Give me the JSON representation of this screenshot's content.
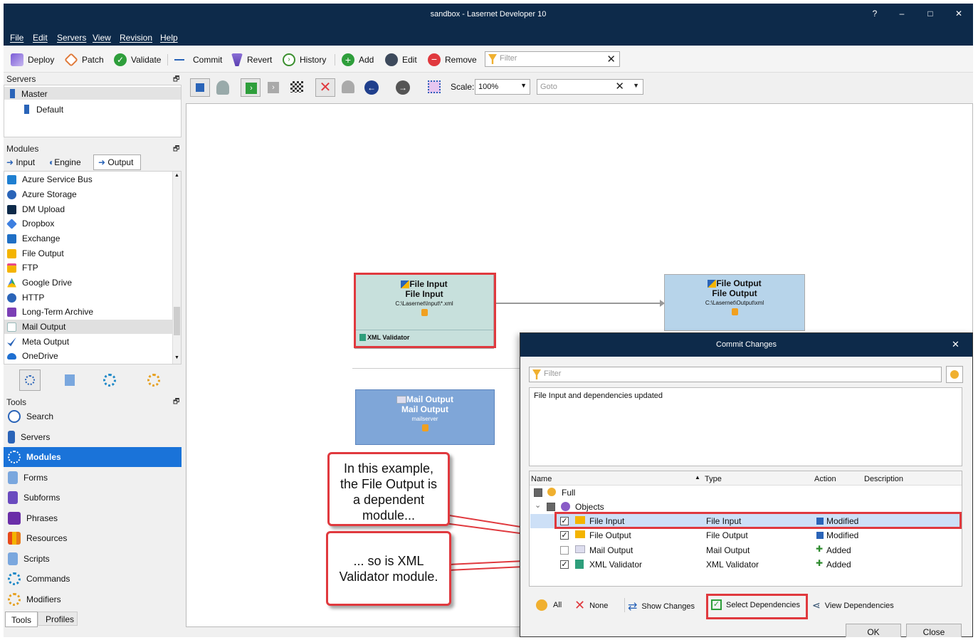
{
  "window": {
    "title": "sandbox - Lasernet Developer 10",
    "controls": [
      "?",
      "–",
      "□",
      "✕"
    ]
  },
  "menu": [
    "File",
    "Edit",
    "Servers",
    "View",
    "Revision",
    "Help"
  ],
  "toolbar": {
    "deploy": "Deploy",
    "patch": "Patch",
    "validate": "Validate",
    "commit": "Commit",
    "revert": "Revert",
    "history": "History",
    "add": "Add",
    "edit": "Edit",
    "remove": "Remove",
    "filter_placeholder": "Filter"
  },
  "servers": {
    "header": "Servers",
    "items": [
      "Master",
      "Default"
    ]
  },
  "modules": {
    "header": "Modules",
    "tabs": [
      "Input",
      "Engine",
      "Output"
    ],
    "items": [
      "Azure Service Bus",
      "Azure Storage",
      "DM Upload",
      "Dropbox",
      "Exchange",
      "File Output",
      "FTP",
      "Google Drive",
      "HTTP",
      "Long-Term Archive",
      "Mail Output",
      "Meta Output",
      "OneDrive"
    ],
    "selected": "Mail Output"
  },
  "tools": {
    "header": "Tools",
    "items": [
      "Search",
      "Servers",
      "Modules",
      "Forms",
      "Subforms",
      "Phrases",
      "Resources",
      "Scripts",
      "Commands",
      "Modifiers"
    ],
    "selected": "Modules",
    "bottom_tabs": [
      "Tools",
      "Profiles"
    ]
  },
  "canvas_toolbar": {
    "scale_label": "Scale:",
    "scale_value": "100%",
    "goto_placeholder": "Goto"
  },
  "nodes": {
    "file_input": {
      "title": "File Input",
      "name": "File Input",
      "path": "C:\\Lasernet\\Input\\*.xml",
      "validator": "XML Validator"
    },
    "file_output": {
      "title": "File Output",
      "name": "File Output",
      "path": "C:\\Lasernet\\Output\\xml"
    },
    "mail_output": {
      "title": "Mail Output",
      "name": "Mail Output",
      "server": "mailserver"
    }
  },
  "callouts": {
    "first": "In this example, the File Output is a dependent module...",
    "second": "... so is XML Validator module."
  },
  "dialog": {
    "title": "Commit Changes",
    "filter_placeholder": "Filter",
    "message": "File Input and dependencies updated",
    "columns": [
      "Name",
      "Type",
      "Action",
      "Description"
    ],
    "tree": {
      "full": "Full",
      "objects": "Objects"
    },
    "rows": [
      {
        "name": "File Input",
        "type": "File Input",
        "action": "Modified",
        "checked": true
      },
      {
        "name": "File Output",
        "type": "File Output",
        "action": "Modified",
        "checked": true
      },
      {
        "name": "Mail Output",
        "type": "Mail Output",
        "action": "Added",
        "checked": false
      },
      {
        "name": "XML Validator",
        "type": "XML Validator",
        "action": "Added",
        "checked": true
      }
    ],
    "buttons": {
      "all": "All",
      "none": "None",
      "show_changes": "Show Changes",
      "select_dependencies": "Select Dependencies",
      "view_dependencies": "View Dependencies",
      "ok": "OK",
      "close": "Close"
    }
  }
}
